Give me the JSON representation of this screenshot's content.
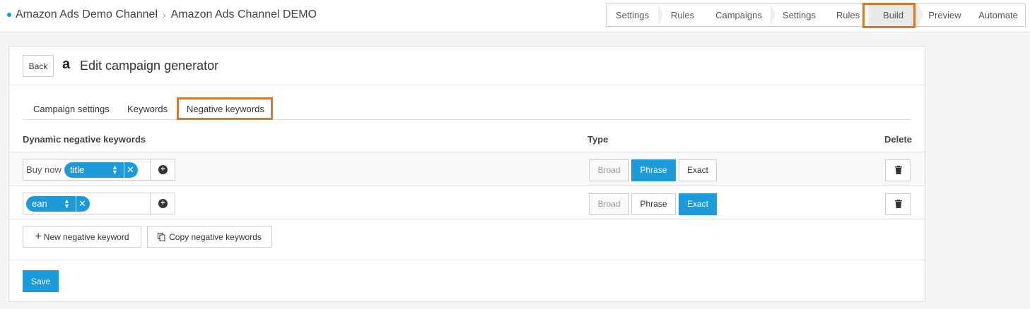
{
  "breadcrumb": {
    "parent": "Amazon Ads Demo Channel",
    "current": "Amazon Ads Channel DEMO",
    "accent": "#1d9bd8"
  },
  "steps": [
    "Settings",
    "Rules",
    "Campaigns",
    "Settings",
    "Rules",
    "Build",
    "Preview",
    "Automate"
  ],
  "header": {
    "back_label": "Back",
    "logo_glyph": "a",
    "title": "Edit campaign generator"
  },
  "tabs": [
    "Campaign settings",
    "Keywords",
    "Negative keywords"
  ],
  "table": {
    "col_keywords": "Dynamic negative keywords",
    "col_type": "Type",
    "col_delete": "Delete",
    "rows": [
      {
        "prefix": "Buy now",
        "pill": "title",
        "types": [
          "Broad",
          "Phrase",
          "Exact"
        ],
        "selected": "Phrase"
      },
      {
        "prefix": "",
        "pill": "ean",
        "types": [
          "Broad",
          "Phrase",
          "Exact"
        ],
        "selected": "Exact"
      }
    ]
  },
  "actions": {
    "new_label": "New negative keyword",
    "copy_label": "Copy negative keywords",
    "save_label": "Save"
  },
  "icons": {
    "add": "add-circle-icon",
    "remove": "close-icon",
    "sort": "updown-icon",
    "delete": "trash-icon",
    "plus": "plus-icon",
    "copy": "copy-icon"
  },
  "colors": {
    "primary": "#1d9bd8",
    "highlight": "#d57a2c"
  }
}
